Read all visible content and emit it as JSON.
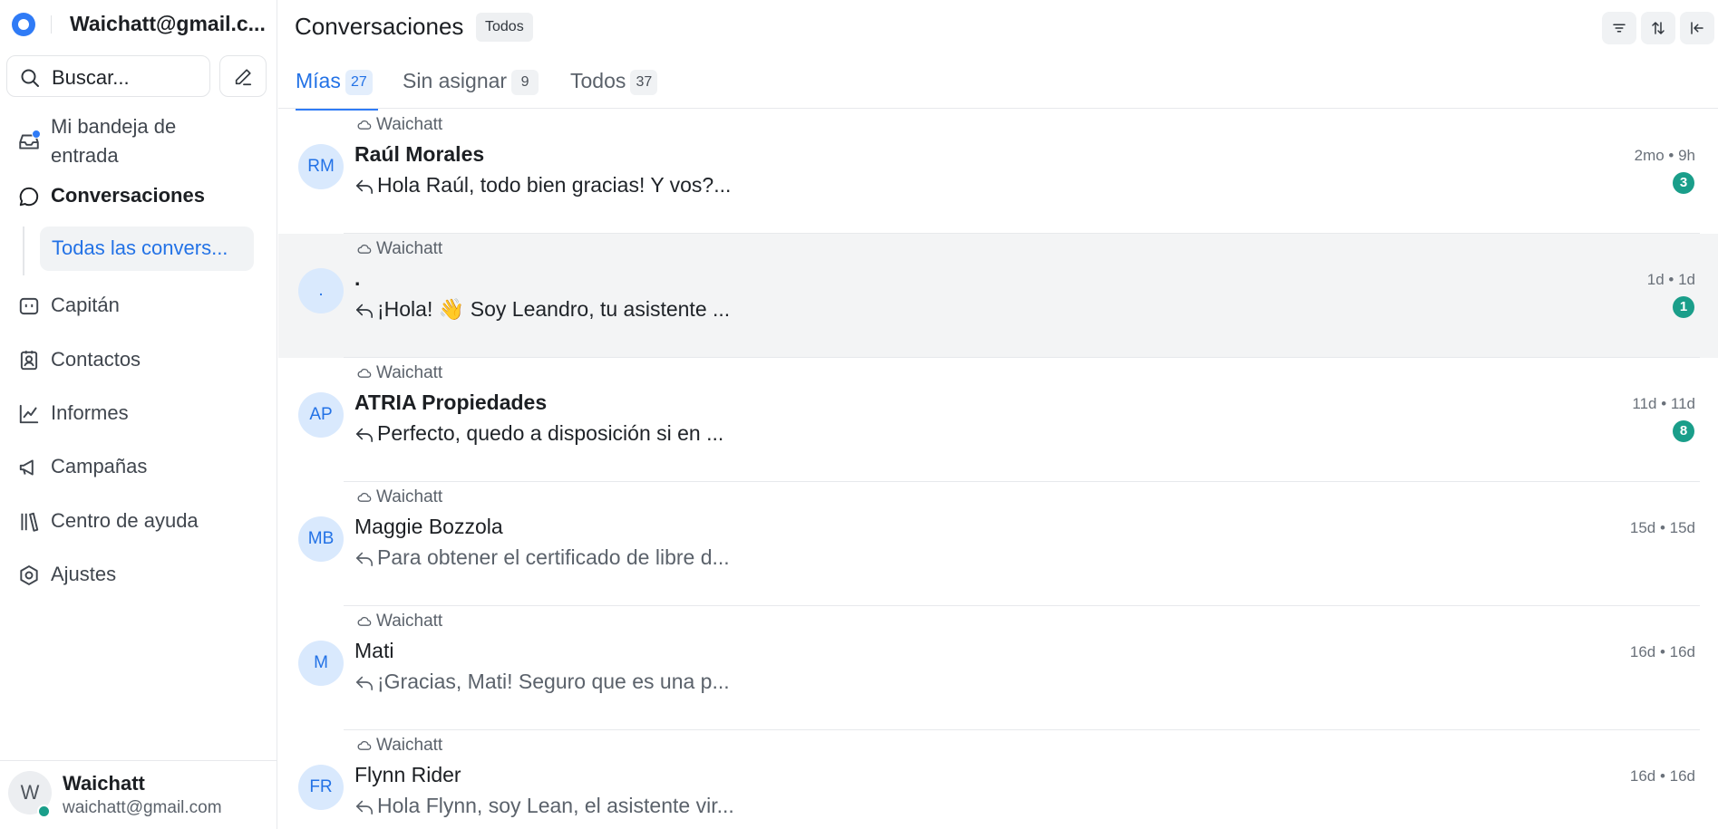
{
  "sidebar": {
    "account": "Waichatt@gmail.c...",
    "search_placeholder": "Buscar...",
    "nav": {
      "inbox": "Mi bandeja de entrada",
      "conversations": "Conversaciones",
      "all_conversations": "Todas las convers...",
      "captain": "Capitán",
      "contacts": "Contactos",
      "reports": "Informes",
      "campaigns": "Campañas",
      "help_center": "Centro de ayuda",
      "settings": "Ajustes"
    },
    "user": {
      "initial": "W",
      "name": "Waichatt",
      "email": "waichatt@gmail.com"
    }
  },
  "header": {
    "title": "Conversaciones",
    "filter_pill": "Todos"
  },
  "tabs": [
    {
      "label": "Mías",
      "count": "27"
    },
    {
      "label": "Sin asignar",
      "count": "9"
    },
    {
      "label": "Todos",
      "count": "37"
    }
  ],
  "conversations": [
    {
      "initials": "RM",
      "inbox": "Waichatt",
      "name": "Raúl Morales",
      "message": "Hola Raúl, todo bien gracias! Y vos?...",
      "time": "2mo • 9h",
      "unread": "3"
    },
    {
      "initials": ".",
      "inbox": "Waichatt",
      "name": ".",
      "message": "¡Hola! 👋 Soy Leandro, tu asistente ...",
      "time": "1d • 1d",
      "unread": "1"
    },
    {
      "initials": "AP",
      "inbox": "Waichatt",
      "name": "ATRIA Propiedades",
      "message": "Perfecto, quedo a disposición si en ...",
      "time": "11d • 11d",
      "unread": "8"
    },
    {
      "initials": "MB",
      "inbox": "Waichatt",
      "name": "Maggie Bozzola",
      "message": "Para obtener el certificado de libre d...",
      "time": "15d • 15d",
      "unread": ""
    },
    {
      "initials": "M",
      "inbox": "Waichatt",
      "name": "Mati",
      "message": "¡Gracias, Mati! Seguro que es una p...",
      "time": "16d • 16d",
      "unread": ""
    },
    {
      "initials": "FR",
      "inbox": "Waichatt",
      "name": "Flynn Rider",
      "message": "Hola Flynn, soy Lean, el asistente vir...",
      "time": "16d • 16d",
      "unread": ""
    }
  ],
  "colors": {
    "accent": "#2f7bf6",
    "badge": "#1a9e8a",
    "selected_row": "#f3f4f5",
    "avatar_bg": "#d9e9fd"
  }
}
